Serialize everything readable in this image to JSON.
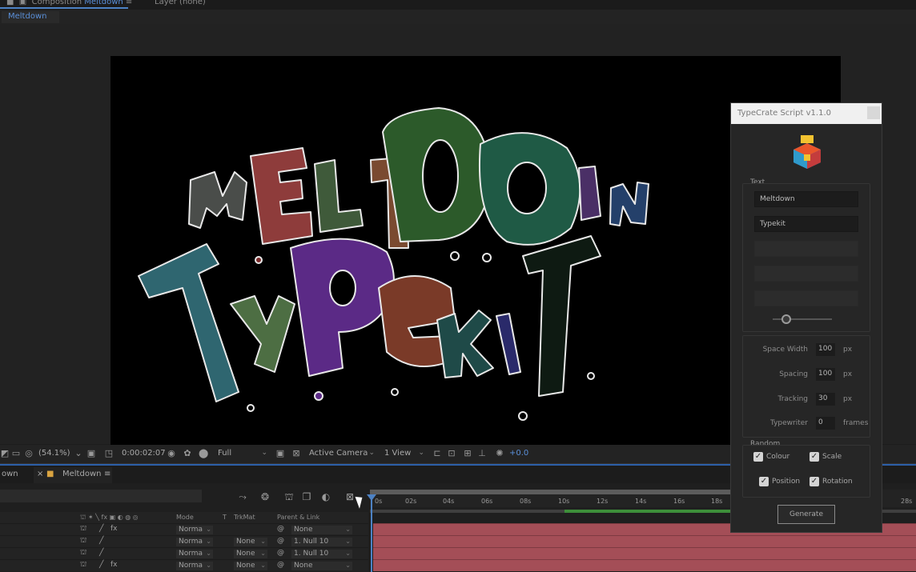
{
  "composition": {
    "tab_prefix": "Composition",
    "tab_name": "Meltdown",
    "layer_tab": "Layer (none)",
    "breadcrumb": "Meltdown"
  },
  "viewer_toolbar": {
    "zoom": "(54.1%)",
    "timecode": "0:00:02:07",
    "resolution": "Full",
    "camera": "Active Camera",
    "view": "1 View",
    "exposure": "+0.0"
  },
  "timeline": {
    "left_tab": "own",
    "active_tab": "Meltdown",
    "columns": [
      "Mode",
      "T",
      "TrkMat",
      "Parent & Link"
    ],
    "ticks": [
      "0s",
      "02s",
      "04s",
      "06s",
      "08s",
      "10s",
      "12s",
      "14s",
      "16s",
      "18s",
      "28s"
    ],
    "rows": [
      {
        "mode": "Norma",
        "trkmat": "",
        "parent": "None",
        "fx": true
      },
      {
        "mode": "Norma",
        "trkmat": "None",
        "parent": "1. Null 10",
        "fx": false
      },
      {
        "mode": "Norma",
        "trkmat": "None",
        "parent": "1. Null 10",
        "fx": false
      },
      {
        "mode": "Norma",
        "trkmat": "None",
        "parent": "None",
        "fx": true
      }
    ]
  },
  "panel": {
    "title": "TypeCrate Script v1.1.0",
    "text_group_label": "Text",
    "text_fields": [
      "Meltdown",
      "Typekit",
      "",
      "",
      ""
    ],
    "properties": [
      {
        "label": "Space Width",
        "value": "100",
        "unit": "px"
      },
      {
        "label": "Spacing",
        "value": "100",
        "unit": "px"
      },
      {
        "label": "Tracking",
        "value": "30",
        "unit": "px"
      },
      {
        "label": "Typewriter",
        "value": "0",
        "unit": "frames"
      }
    ],
    "random_group_label": "Random",
    "checkboxes": [
      {
        "label": "Colour",
        "checked": true
      },
      {
        "label": "Scale",
        "checked": true
      },
      {
        "label": "Position",
        "checked": true
      },
      {
        "label": "Rotation",
        "checked": true
      }
    ],
    "generate_label": "Generate"
  },
  "colors": {
    "accent": "#4d82c4",
    "track": "#a44e57",
    "work_area": "#3d8f3a"
  }
}
